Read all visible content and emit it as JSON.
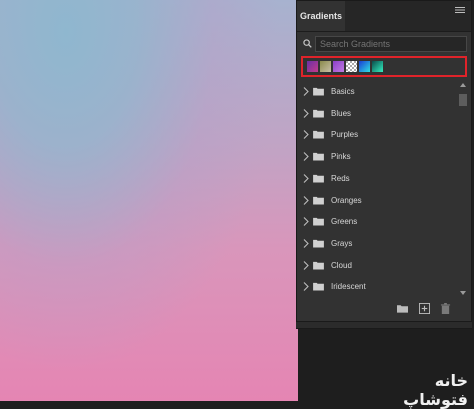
{
  "panel": {
    "tab_label": "Gradients",
    "menu_icon": "panel-menu-icon",
    "search_placeholder": "Search Gradients"
  },
  "recent_presets": [
    {
      "name": "purple-swatch",
      "colors": [
        "#6a2fa4",
        "#c23c8c"
      ]
    },
    {
      "name": "olive-swatch",
      "colors": [
        "#8a8a4a",
        "#c8c0a8"
      ]
    },
    {
      "name": "violet-swatch",
      "colors": [
        "#8b3fc9",
        "#c07ae0"
      ]
    },
    {
      "name": "checker-swatch",
      "colors": [
        "#ffffff",
        "#aaaaaa"
      ]
    },
    {
      "name": "blue-cyan-swatch",
      "colors": [
        "#1a3dd6",
        "#2ee0e0"
      ]
    },
    {
      "name": "teal-swatch",
      "colors": [
        "#0a4a4a",
        "#33f0c0"
      ]
    }
  ],
  "folders": [
    {
      "label": "Basics"
    },
    {
      "label": "Blues"
    },
    {
      "label": "Purples"
    },
    {
      "label": "Pinks"
    },
    {
      "label": "Reds"
    },
    {
      "label": "Oranges"
    },
    {
      "label": "Greens"
    },
    {
      "label": "Grays"
    },
    {
      "label": "Cloud"
    },
    {
      "label": "Iridescent"
    }
  ],
  "footer": {
    "icons": [
      "new-group-folder-icon",
      "new-gradient-icon",
      "delete-icon"
    ]
  },
  "watermark": {
    "text": "خانه فتوشاپ"
  },
  "colors": {
    "highlight_border": "#e0232a",
    "panel_bg": "#323232"
  }
}
